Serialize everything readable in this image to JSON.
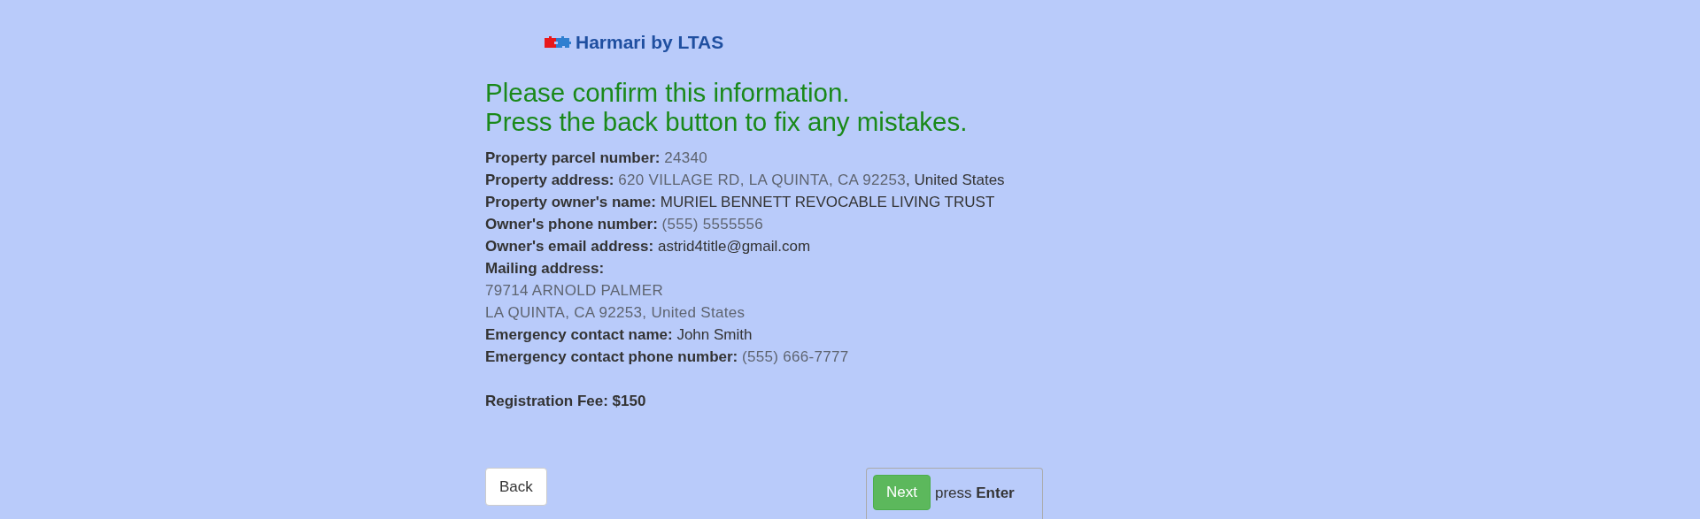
{
  "brand": {
    "title": "Harmari by LTAS"
  },
  "heading": [
    "Please confirm this information.",
    "Press the back button to fix any mistakes."
  ],
  "details": [
    {
      "label": "Property parcel number:",
      "parts": [
        {
          "text": "24340",
          "blurred": true
        }
      ]
    },
    {
      "label": "Property address:",
      "parts": [
        {
          "text": "620 VILLAGE RD, LA QUINTA, CA 92253",
          "blurred": true
        },
        {
          "text": ", United States",
          "blurred": false
        }
      ]
    },
    {
      "label": "Property owner's name:",
      "parts": [
        {
          "text": "MURIEL BENNETT REVOCABLE LIVING TRUST",
          "blurred": false
        }
      ]
    },
    {
      "label": "Owner's phone number:",
      "parts": [
        {
          "text": "(555) 5555556",
          "blurred": true
        }
      ]
    },
    {
      "label": "Owner's email address:",
      "parts": [
        {
          "text": "astrid4title@gmail.com",
          "blurred": false
        }
      ]
    },
    {
      "label": "Mailing address:"
    },
    {
      "parts": [
        {
          "text": "79714 ARNOLD PALMER",
          "blurred": true
        }
      ]
    },
    {
      "parts": [
        {
          "text": "LA QUINTA, CA 92253, United States",
          "blurred": true
        }
      ]
    },
    {
      "label": "Emergency contact name:",
      "parts": [
        {
          "text": "John Smith",
          "blurred": false
        }
      ]
    },
    {
      "label": "Emergency contact phone number:",
      "parts": [
        {
          "text": "(555) 666-7777",
          "blurred": true
        }
      ]
    }
  ],
  "fee": "Registration Fee: $150",
  "back_button": "Back",
  "next": {
    "button": "Next",
    "hint": "press **Enter**"
  }
}
